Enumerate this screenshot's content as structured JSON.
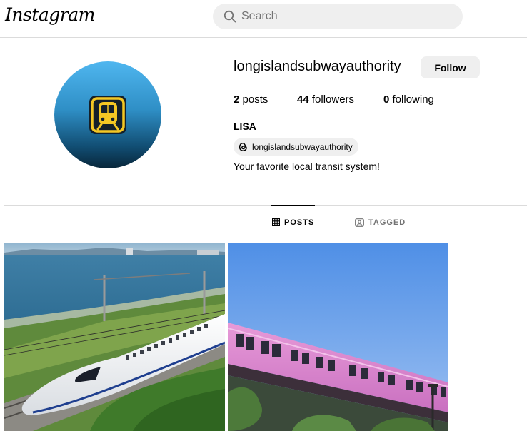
{
  "header": {
    "logo_text": "Instagram",
    "search_placeholder": "Search"
  },
  "profile": {
    "username": "longislandsubwayauthority",
    "follow_label": "Follow",
    "stats": {
      "posts_count": "2",
      "posts_label": "posts",
      "followers_count": "44",
      "followers_label": "followers",
      "following_count": "0",
      "following_label": "following"
    },
    "full_name": "LISA",
    "threads_handle": "longislandsubwayauthority",
    "bio": "Your favorite local transit system!"
  },
  "tabs": [
    {
      "label": "POSTS",
      "icon": "grid-icon",
      "active": true
    },
    {
      "label": "TAGGED",
      "icon": "tagged-icon",
      "active": false
    }
  ],
  "posts": [
    {
      "subject": "white high-speed bullet train by the sea"
    },
    {
      "subject": "pink elevated train under blue sky"
    }
  ],
  "colors": {
    "follow_bg": "#efefef",
    "search_bg": "#efefef",
    "avatar_top": "#4fb6ef",
    "avatar_bottom": "#08263a",
    "icon_yellow": "#f4c724"
  }
}
